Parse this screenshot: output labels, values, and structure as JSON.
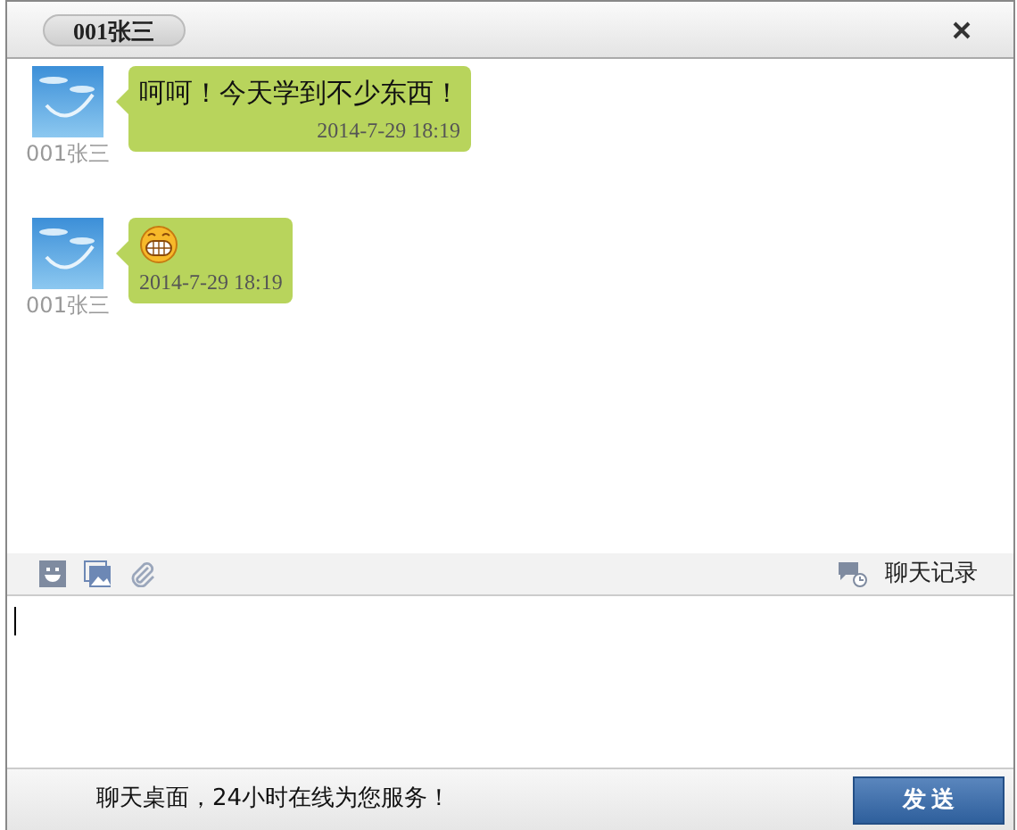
{
  "window": {
    "title": "001张三"
  },
  "messages": [
    {
      "kind": "text",
      "sender": "001张三",
      "text": "呵呵！今天学到不少东西！",
      "time": "2014-7-29 18:19"
    },
    {
      "kind": "emoji",
      "sender": "001张三",
      "time": "2014-7-29 18:19"
    }
  ],
  "toolbar": {
    "history_label": "聊天记录"
  },
  "footer": {
    "slogan": "聊天桌面，24小时在线为您服务！",
    "send_button": "发 送"
  }
}
